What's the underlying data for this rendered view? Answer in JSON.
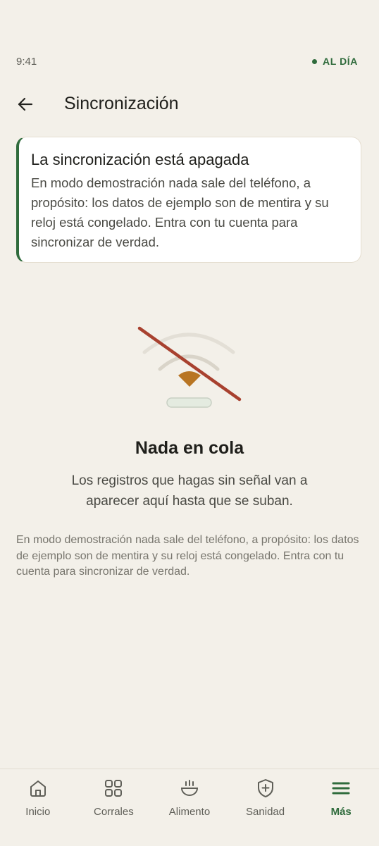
{
  "status_bar": {
    "time": "9:41",
    "sync_status": "AL DÍA"
  },
  "header": {
    "title": "Sincronización"
  },
  "notice": {
    "title": "La sincronización está apagada",
    "body": "En modo demostración nada sale del teléfono, a propósito: los datos de ejemplo son de mentira y su reloj está congelado. Entra con tu cuenta para sincronizar de verdad."
  },
  "empty_state": {
    "icon": "wifi-off-icon",
    "title": "Nada en cola",
    "body": "Los registros que hagas sin señal van a aparecer aquí hasta que se suban."
  },
  "footnote": "En modo demostración nada sale del teléfono, a propósito: los datos de ejemplo son de mentira y su reloj está congelado. Entra con tu cuenta para sincronizar de verdad.",
  "nav": {
    "items": [
      {
        "label": "Inicio",
        "icon": "home-icon"
      },
      {
        "label": "Corrales",
        "icon": "grid-icon"
      },
      {
        "label": "Alimento",
        "icon": "feed-bowl-icon"
      },
      {
        "label": "Sanidad",
        "icon": "health-shield-icon"
      },
      {
        "label": "Más",
        "icon": "menu-icon"
      }
    ],
    "active": "Más"
  },
  "colors": {
    "accent": "#2f6b3c",
    "background": "#f3f0e9",
    "warning": "#b87523",
    "error_line": "#a8412f"
  }
}
